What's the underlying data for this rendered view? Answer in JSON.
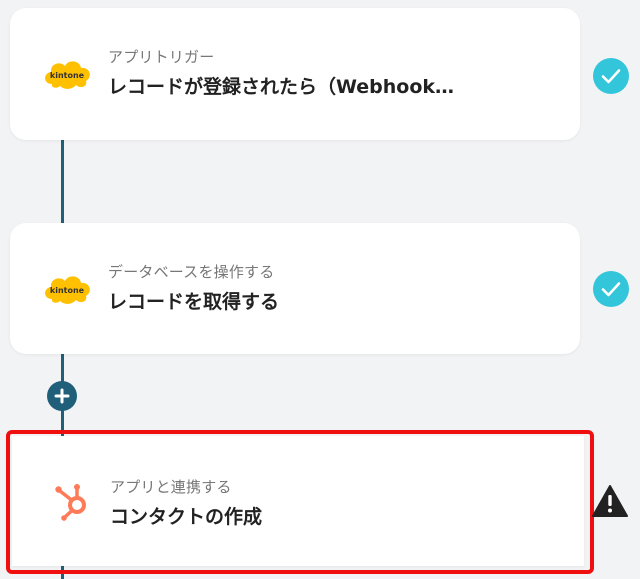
{
  "flow": {
    "steps": [
      {
        "subtitle": "アプリトリガー",
        "title": "レコードが登録されたら（Webhook…",
        "app_icon": "kintone-icon",
        "app_icon_text": "kintone",
        "status": "check-icon"
      },
      {
        "subtitle": "データベースを操作する",
        "title": "レコードを取得する",
        "app_icon": "kintone-icon",
        "app_icon_text": "kintone",
        "status": "check-icon"
      },
      {
        "subtitle": "アプリと連携する",
        "title": "コンタクトの作成",
        "app_icon": "hubspot-icon",
        "status": "warning-icon"
      }
    ],
    "add_button_icon": "plus-icon"
  },
  "colors": {
    "connector": "#1f5f7a",
    "check": "#33c5da",
    "highlight": "#ef0f0f",
    "kintone": "#ffc000",
    "hubspot": "#ff7a59"
  }
}
